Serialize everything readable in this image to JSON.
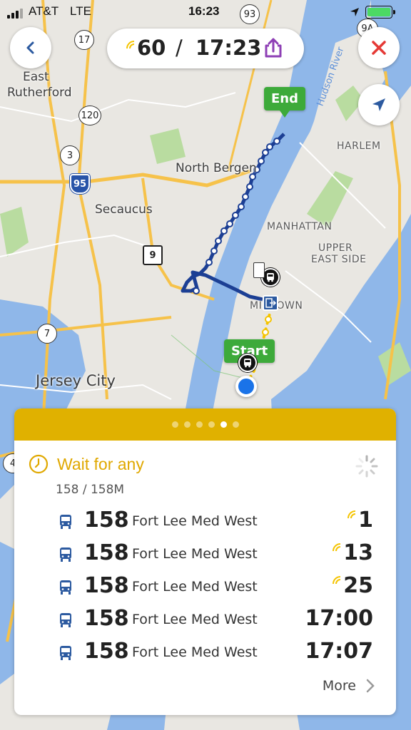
{
  "status_bar": {
    "carrier": "AT&T",
    "network": "LTE",
    "time": "16:23"
  },
  "top_bar": {
    "eta_minutes": "60",
    "separator": "/",
    "arrival_time": "17:23"
  },
  "map": {
    "labels": {
      "east_rutherford_1": "East",
      "east_rutherford_2": "Rutherford",
      "north_bergen": "North Bergen",
      "secaucus": "Secaucus",
      "manhattan": "MANHATTAN",
      "upper_east_side_1": "UPPER",
      "upper_east_side_2": "EAST SIDE",
      "harlem": "HARLEM",
      "midtown": "MIDTOWN",
      "jersey_city": "Jersey City",
      "hudson_river": "Hudson River"
    },
    "shields": {
      "r17": "17",
      "r120": "120",
      "r3": "3",
      "r95": "95",
      "r9": "9",
      "r7": "7",
      "r93": "93",
      "r9a": "9A",
      "r4": "4"
    },
    "markers": {
      "end": "End",
      "start": "Start"
    },
    "colors": {
      "route_bus": "#1c3f94",
      "route_walk": "#f5c400",
      "marker_green": "#3daa3a"
    }
  },
  "card": {
    "accent_color": "#e0b100",
    "page_count": 6,
    "active_page": 4,
    "wait_title": "Wait for any",
    "route_subtitle": "158 / 158M",
    "departures": [
      {
        "route": "158",
        "destination": "Fort Lee Med West",
        "time": "1",
        "realtime": true
      },
      {
        "route": "158",
        "destination": "Fort Lee Med West",
        "time": "13",
        "realtime": true
      },
      {
        "route": "158",
        "destination": "Fort Lee Med West",
        "time": "25",
        "realtime": true
      },
      {
        "route": "158",
        "destination": "Fort Lee Med West",
        "time": "17:00",
        "realtime": false
      },
      {
        "route": "158",
        "destination": "Fort Lee Med West",
        "time": "17:07",
        "realtime": false
      }
    ],
    "more_label": "More"
  },
  "icons": [
    "back-arrow-icon",
    "share-icon",
    "close-icon",
    "navigate-arrow-icon",
    "clock-icon",
    "spinner-icon",
    "bus-icon",
    "realtime-signal-icon",
    "chevron-right-icon"
  ]
}
